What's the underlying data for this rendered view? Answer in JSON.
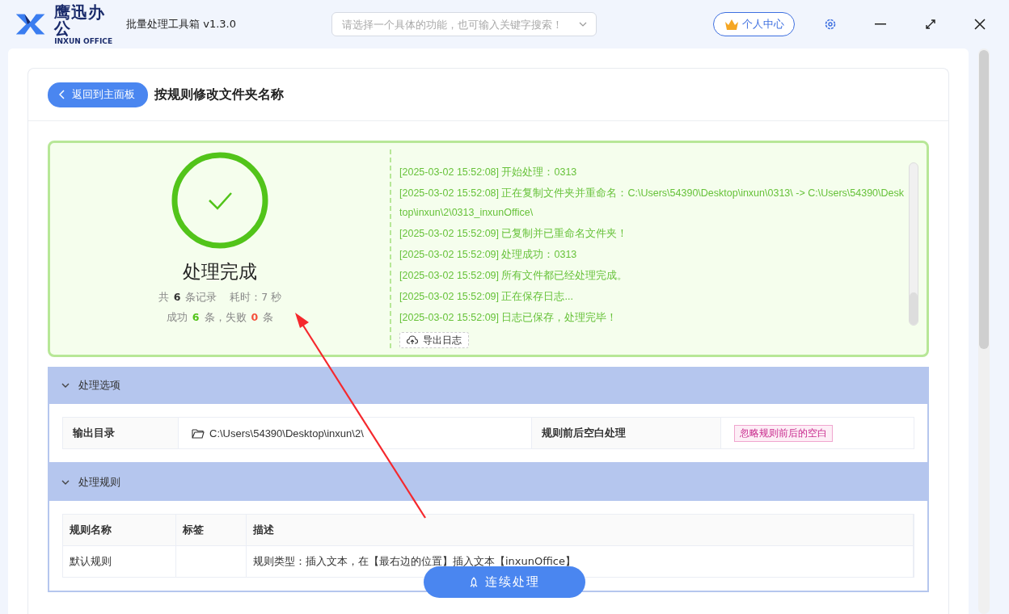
{
  "app": {
    "brand": "鹰迅办公",
    "brand_sub": "INXUN OFFICE",
    "title": "批量处理工具箱 v1.3.0"
  },
  "search": {
    "placeholder": "请选择一个具体的功能，也可输入关键字搜索！"
  },
  "user_button": "个人中心",
  "header": {
    "back_button": "返回到主面板",
    "title": "按规则修改文件夹名称"
  },
  "result": {
    "status": "处理完成",
    "total_prefix": "共",
    "total": "6",
    "total_suffix": "条记录",
    "time_label": "耗时：",
    "time": "7",
    "time_unit": "秒",
    "success_label": "成功",
    "success": "6",
    "success_unit": "条，失败",
    "failed": "0",
    "failed_unit": "条"
  },
  "log": {
    "lines": [
      "[2025-03-02 15:52:08] 开始处理：0313",
      "[2025-03-02 15:52:08] 正在复制文件夹并重命名：C:\\Users\\54390\\Desktop\\inxun\\0313\\ -> C:\\Users\\54390\\Desktop\\inxun\\2\\0313_inxunOffice\\",
      "[2025-03-02 15:52:09] 已复制并已重命名文件夹！",
      "[2025-03-02 15:52:09] 处理成功：0313",
      "[2025-03-02 15:52:09] 所有文件都已经处理完成。",
      "[2025-03-02 15:52:09] 正在保存日志...",
      "[2025-03-02 15:52:09] 日志已保存，处理完毕！"
    ],
    "export_button": "导出日志"
  },
  "options_section": {
    "title": "处理选项",
    "expanded": true,
    "output_label": "输出目录",
    "output_path": "C:\\Users\\54390\\Desktop\\inxun\\2\\",
    "trim_label": "规则前后空白处理",
    "trim_tag": "忽略规则前后的空白"
  },
  "rules_section": {
    "title": "处理规则",
    "expanded": true,
    "columns": [
      "规则名称",
      "标签",
      "描述"
    ],
    "rows": [
      [
        "默认规则",
        "",
        "规则类型：插入文本，在【最右边的位置】插入文本【inxunOffice】"
      ]
    ]
  },
  "continue_button": "连续处理"
}
